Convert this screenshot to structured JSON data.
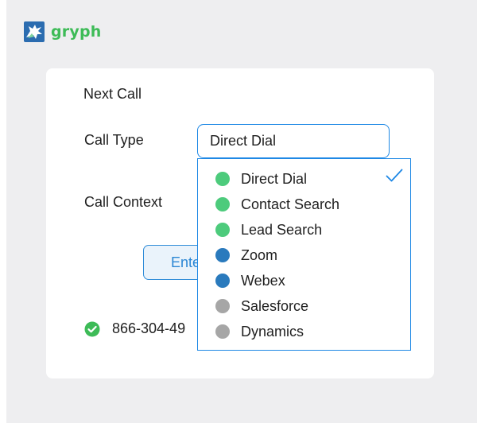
{
  "brand": {
    "name": "gryph",
    "color": "#3dbb57"
  },
  "form": {
    "section_title": "Next Call",
    "call_type_label": "Call Type",
    "call_type_value": "Direct Dial",
    "call_context_label": "Call Context",
    "enter_button_label": "Ente",
    "phone_number": "866-304-49"
  },
  "dropdown": {
    "selected": "Direct Dial",
    "options": [
      {
        "label": "Direct Dial",
        "color": "#4dcb7c",
        "selected": true
      },
      {
        "label": "Contact Search",
        "color": "#4dcb7c",
        "selected": false
      },
      {
        "label": "Lead Search",
        "color": "#4dcb7c",
        "selected": false
      },
      {
        "label": "Zoom",
        "color": "#2a7abd",
        "selected": false
      },
      {
        "label": "Webex",
        "color": "#2a7abd",
        "selected": false
      },
      {
        "label": "Salesforce",
        "color": "#a6a6a6",
        "selected": false
      },
      {
        "label": "Dynamics",
        "color": "#a6a6a6",
        "selected": false
      }
    ]
  },
  "colors": {
    "accent": "#1e88e5",
    "success": "#3dbb57",
    "background": "#eeeef0"
  },
  "icons": {
    "logo": "gryphon-logo-icon",
    "status": "check-circle-icon",
    "selected": "checkmark-icon"
  }
}
